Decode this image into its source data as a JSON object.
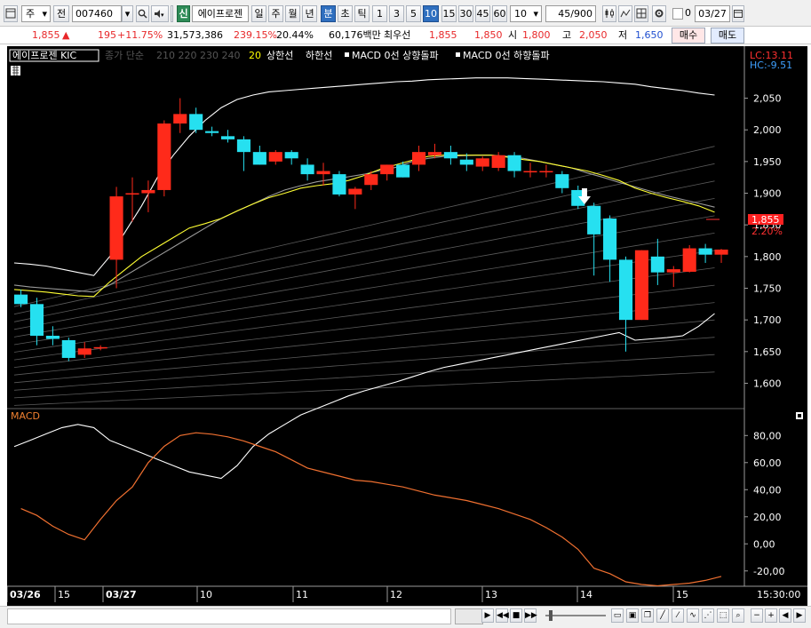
{
  "toolbar": {
    "market_select": "주",
    "prev_label": "전",
    "code_value": "007460",
    "new_badge": "신",
    "stock_name": "에이프로젠",
    "period_day": "일",
    "period_week": "주",
    "period_month": "월",
    "period_year": "년",
    "period_minute": "분",
    "period_second": "초",
    "period_tick": "틱",
    "intervals": [
      "1",
      "3",
      "5",
      "10",
      "15",
      "30",
      "45",
      "60"
    ],
    "interval_active": "10",
    "interval_select": "10",
    "count_value": "45",
    "count_total": "/900",
    "check_label": "0",
    "date_value": "03/27"
  },
  "info": {
    "price": "1,855",
    "arrow": "▲",
    "change": "195",
    "change_pct": "+11.75%",
    "volume": "31,573,386",
    "vol_ratio": "239.15%",
    "turnover": "20.44%",
    "amount": "60,176백만",
    "pref_label": "최우선",
    "ask": "1,855",
    "bid": "1,850",
    "open_label": "시",
    "open": "1,800",
    "high_label": "고",
    "high": "2,050",
    "low_label": "저",
    "low": "1,650",
    "buy_label": "매수",
    "sell_label": "매도"
  },
  "legend": {
    "name": "에이프로젠 KIC",
    "ma_label": "종가 단순",
    "ma_periods": [
      "210",
      "220",
      "230",
      "240"
    ],
    "ma20": "20",
    "upper_label": "상한선",
    "lower_label": "하한선",
    "macd_up": "MACD 0선 상향돌파",
    "macd_down": "MACD 0선 하향돌파",
    "lc": "LC:13.11",
    "hc": "HC:-9.51",
    "current_price_tag": "1,855",
    "current_pct_tag": "2.20%",
    "macd_title": "MACD"
  },
  "chart_data": [
    {
      "type": "candlestick",
      "title": "에이프로젠 KIC",
      "ylim": [
        1560,
        2090
      ],
      "yticks": [
        1600,
        1650,
        1700,
        1750,
        1800,
        1850,
        1900,
        1950,
        2000,
        2050
      ],
      "ytick_labels": [
        "1,600",
        "1,650",
        "1,700",
        "1,750",
        "1,800",
        "1,850",
        "1,900",
        "1,950",
        "2,000",
        "2,050"
      ],
      "candles": [
        {
          "o": 1740,
          "h": 1748,
          "l": 1720,
          "c": 1725
        },
        {
          "o": 1725,
          "h": 1735,
          "l": 1660,
          "c": 1675
        },
        {
          "o": 1675,
          "h": 1690,
          "l": 1660,
          "c": 1670
        },
        {
          "o": 1668,
          "h": 1672,
          "l": 1635,
          "c": 1640
        },
        {
          "o": 1645,
          "h": 1665,
          "l": 1640,
          "c": 1655
        },
        {
          "o": 1655,
          "h": 1660,
          "l": 1652,
          "c": 1657
        },
        {
          "o": 1795,
          "h": 1910,
          "l": 1750,
          "c": 1895
        },
        {
          "o": 1898,
          "h": 1925,
          "l": 1855,
          "c": 1900
        },
        {
          "o": 1900,
          "h": 1920,
          "l": 1870,
          "c": 1905
        },
        {
          "o": 1905,
          "h": 2015,
          "l": 1895,
          "c": 2010
        },
        {
          "o": 2010,
          "h": 2050,
          "l": 1995,
          "c": 2025
        },
        {
          "o": 2025,
          "h": 2035,
          "l": 1995,
          "c": 2000
        },
        {
          "o": 1998,
          "h": 2005,
          "l": 1990,
          "c": 1995
        },
        {
          "o": 1990,
          "h": 2000,
          "l": 1980,
          "c": 1985
        },
        {
          "o": 1985,
          "h": 1990,
          "l": 1935,
          "c": 1965
        },
        {
          "o": 1965,
          "h": 1975,
          "l": 1945,
          "c": 1945
        },
        {
          "o": 1950,
          "h": 1968,
          "l": 1945,
          "c": 1965
        },
        {
          "o": 1965,
          "h": 1968,
          "l": 1945,
          "c": 1955
        },
        {
          "o": 1945,
          "h": 1955,
          "l": 1920,
          "c": 1930
        },
        {
          "o": 1930,
          "h": 1948,
          "l": 1912,
          "c": 1935
        },
        {
          "o": 1930,
          "h": 1935,
          "l": 1895,
          "c": 1898
        },
        {
          "o": 1898,
          "h": 1910,
          "l": 1875,
          "c": 1907
        },
        {
          "o": 1913,
          "h": 1935,
          "l": 1905,
          "c": 1930
        },
        {
          "o": 1930,
          "h": 1945,
          "l": 1920,
          "c": 1945
        },
        {
          "o": 1945,
          "h": 1950,
          "l": 1925,
          "c": 1925
        },
        {
          "o": 1945,
          "h": 1975,
          "l": 1935,
          "c": 1965
        },
        {
          "o": 1960,
          "h": 1978,
          "l": 1955,
          "c": 1965
        },
        {
          "o": 1965,
          "h": 1975,
          "l": 1945,
          "c": 1955
        },
        {
          "o": 1953,
          "h": 1963,
          "l": 1935,
          "c": 1945
        },
        {
          "o": 1942,
          "h": 1958,
          "l": 1935,
          "c": 1955
        },
        {
          "o": 1940,
          "h": 1965,
          "l": 1935,
          "c": 1960
        },
        {
          "o": 1960,
          "h": 1965,
          "l": 1925,
          "c": 1935
        },
        {
          "o": 1935,
          "h": 1948,
          "l": 1925,
          "c": 1935
        },
        {
          "o": 1935,
          "h": 1945,
          "l": 1925,
          "c": 1935
        },
        {
          "o": 1930,
          "h": 1935,
          "l": 1900,
          "c": 1908
        },
        {
          "o": 1905,
          "h": 1912,
          "l": 1875,
          "c": 1880
        },
        {
          "o": 1880,
          "h": 1885,
          "l": 1770,
          "c": 1835
        },
        {
          "o": 1860,
          "h": 1865,
          "l": 1760,
          "c": 1795
        },
        {
          "o": 1795,
          "h": 1800,
          "l": 1650,
          "c": 1700
        },
        {
          "o": 1700,
          "h": 1810,
          "l": 1700,
          "c": 1810
        },
        {
          "o": 1800,
          "h": 1828,
          "l": 1755,
          "c": 1775
        },
        {
          "o": 1775,
          "h": 1785,
          "l": 1752,
          "c": 1780
        },
        {
          "o": 1776,
          "h": 1818,
          "l": 1775,
          "c": 1813
        },
        {
          "o": 1813,
          "h": 1820,
          "l": 1790,
          "c": 1803
        },
        {
          "o": 1803,
          "h": 1812,
          "l": 1790,
          "c": 1811
        }
      ],
      "bollinger_upper": [
        1790,
        1788,
        1785,
        1780,
        1775,
        1770,
        1800,
        1840,
        1880,
        1925,
        1960,
        1990,
        2015,
        2035,
        2048,
        2055,
        2060,
        2062,
        2064,
        2066,
        2068,
        2070,
        2072,
        2074,
        2076,
        2077,
        2079,
        2080,
        2081,
        2082,
        2082,
        2082,
        2081,
        2080,
        2079,
        2078,
        2077,
        2076,
        2074,
        2072,
        2068,
        2065,
        2062,
        2058,
        2055
      ],
      "bollinger_mid": [
        1755,
        1752,
        1750,
        1748,
        1746,
        1744,
        1755,
        1770,
        1785,
        1800,
        1815,
        1830,
        1845,
        1860,
        1872,
        1883,
        1895,
        1905,
        1912,
        1918,
        1922,
        1926,
        1930,
        1936,
        1941,
        1950,
        1955,
        1958,
        1959,
        1960,
        1960,
        1958,
        1955,
        1950,
        1945,
        1940,
        1932,
        1925,
        1917,
        1910,
        1903,
        1896,
        1890,
        1884,
        1878
      ],
      "bollinger_lower": [
        1500,
        1510,
        1520,
        1530,
        1535,
        1530,
        1510,
        1500,
        1490,
        1480,
        1470,
        1460,
        1455,
        1450,
        1470,
        1500,
        1520,
        1535,
        1550,
        1560,
        1570,
        1580,
        1588,
        1595,
        1602,
        1610,
        1618,
        1625,
        1630,
        1635,
        1640,
        1645,
        1650,
        1655,
        1660,
        1665,
        1670,
        1675,
        1680,
        1668,
        1670,
        1672,
        1675,
        1690,
        1710
      ],
      "ma20": [
        1748,
        1746,
        1744,
        1741,
        1738,
        1737,
        1760,
        1780,
        1800,
        1815,
        1830,
        1845,
        1852,
        1860,
        1872,
        1883,
        1893,
        1900,
        1908,
        1912,
        1915,
        1920,
        1928,
        1938,
        1945,
        1952,
        1958,
        1960,
        1960,
        1960,
        1960,
        1957,
        1953,
        1950,
        1945,
        1940,
        1935,
        1928,
        1920,
        1908,
        1900,
        1893,
        1887,
        1880,
        1870
      ]
    },
    {
      "type": "line",
      "title": "MACD",
      "ylim": [
        -30,
        92
      ],
      "yticks": [
        -20,
        0,
        20,
        40,
        60,
        80
      ],
      "ytick_labels": [
        "-20,00",
        "0,00",
        "20,00",
        "40,00",
        "60,00",
        "80,00"
      ],
      "values": [
        26,
        21,
        13,
        7,
        3,
        18,
        32,
        42,
        60,
        72,
        80,
        82,
        81,
        79,
        76,
        72,
        68,
        62,
        56,
        53,
        50,
        47,
        46,
        44,
        42,
        39,
        36,
        34,
        32,
        29,
        26,
        22,
        18,
        12,
        5,
        -4,
        -18,
        -22,
        -28,
        -30,
        -31,
        -30,
        -29,
        -27,
        -24
      ]
    }
  ],
  "xaxis": {
    "labels": [
      "03/26",
      "15",
      "03/27",
      "10",
      "11",
      "12",
      "13",
      "14",
      "15"
    ],
    "time": "15:30:00"
  }
}
